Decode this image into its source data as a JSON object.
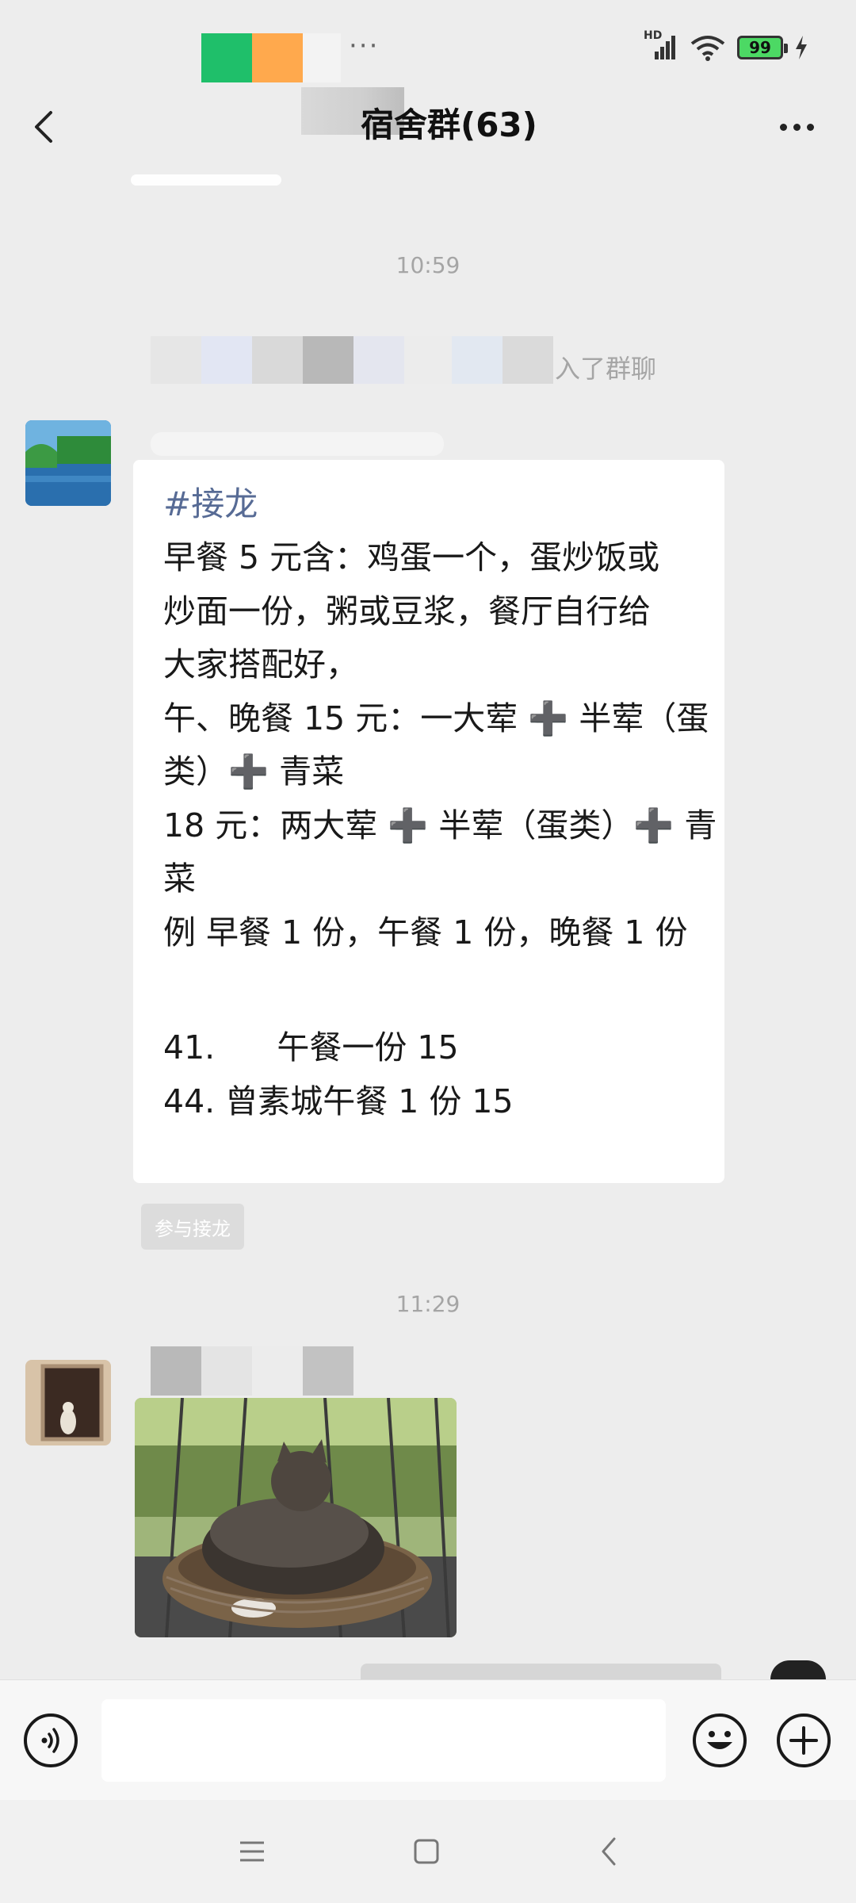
{
  "status_bar": {
    "dots": "···",
    "network": "HD",
    "battery": "99"
  },
  "header": {
    "title": "宿舍群(63)"
  },
  "chat": {
    "timestamp_1": "10:59",
    "system_message": "入了群聊",
    "jielong": {
      "tag": "#接龙",
      "lines": [
        "早餐 5 元含：鸡蛋一个，蛋炒饭或",
        "炒面一份，粥或豆浆，餐厅自行给",
        "大家搭配好，",
        "午、晚餐 15 元：一大荤 ➕ 半荤（蛋",
        "类）➕ 青菜",
        "18 元：两大荤 ➕ 半荤（蛋类）➕ 青",
        "菜",
        "例 早餐 1 份，午餐 1 份，晚餐 1 份"
      ],
      "entry_1": "41.      午餐一份 15",
      "entry_2": "44. 曾素城午餐 1 份 15"
    },
    "join_button": "参与接龙",
    "timestamp_2": "11:29"
  },
  "colors": {
    "background": "#ededed",
    "link_blue": "#576b95",
    "battery_green": "#4cd964"
  },
  "icons": {
    "back": "chevron-left-icon",
    "more": "more-dots-icon",
    "voice": "voice-icon",
    "emoji": "emoji-icon",
    "plus": "plus-icon",
    "nav_menu": "menu-icon",
    "nav_home": "home-icon",
    "nav_back": "back-icon"
  }
}
